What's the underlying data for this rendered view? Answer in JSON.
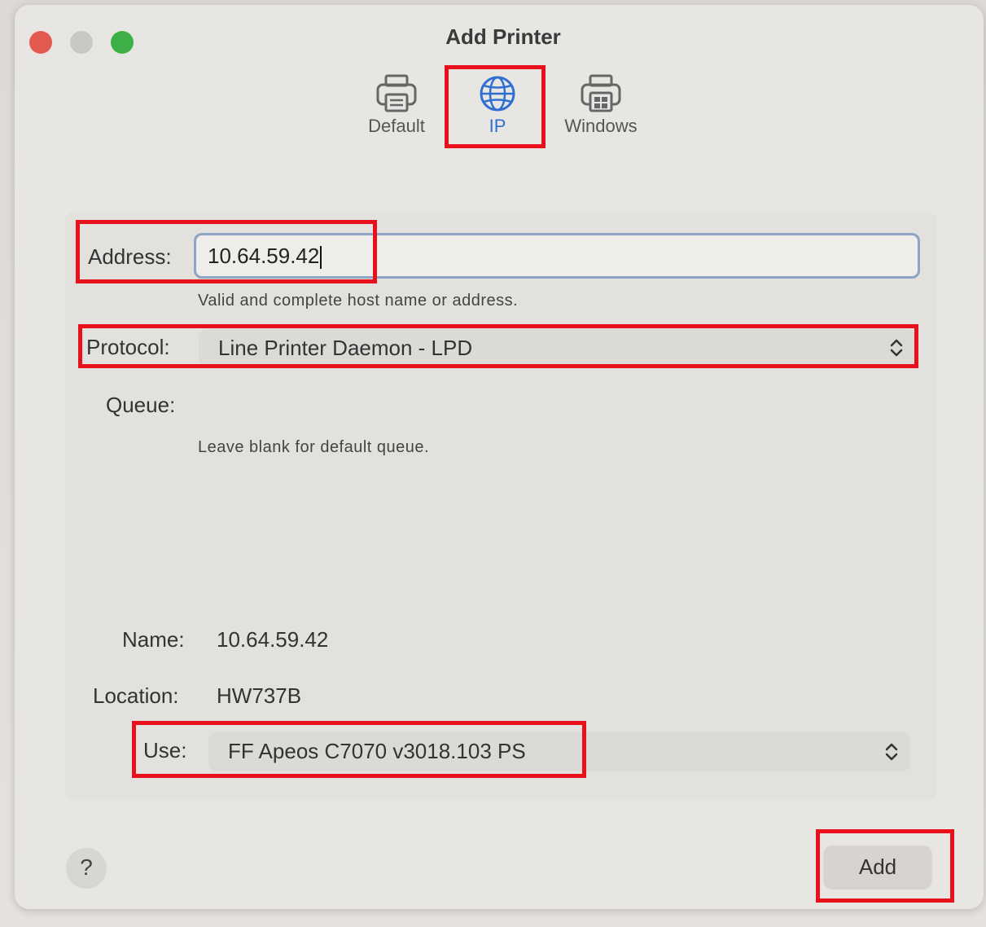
{
  "window": {
    "title": "Add Printer"
  },
  "tabs": [
    {
      "label": "Default",
      "icon": "printer-icon"
    },
    {
      "label": "IP",
      "icon": "globe-icon"
    },
    {
      "label": "Windows",
      "icon": "windows-printer-icon"
    }
  ],
  "selected_tab": "IP",
  "form": {
    "address_label": "Address:",
    "address_value": "10.64.59.42",
    "address_hint": "Valid and complete host name or address.",
    "protocol_label": "Protocol:",
    "protocol_value": "Line Printer Daemon - LPD",
    "queue_label": "Queue:",
    "queue_value": "",
    "queue_hint": "Leave blank for default queue.",
    "name_label": "Name:",
    "name_value": "10.64.59.42",
    "location_label": "Location:",
    "location_value": "HW737B",
    "use_label": "Use:",
    "use_value": "FF Apeos C7070 v3018.103 PS"
  },
  "footer": {
    "help_label": "?",
    "add_label": "Add"
  },
  "colors": {
    "highlight": "#e8101a",
    "selected_tab": "#2f6fd1",
    "close": "#e25a52",
    "zoom": "#3fb047"
  }
}
